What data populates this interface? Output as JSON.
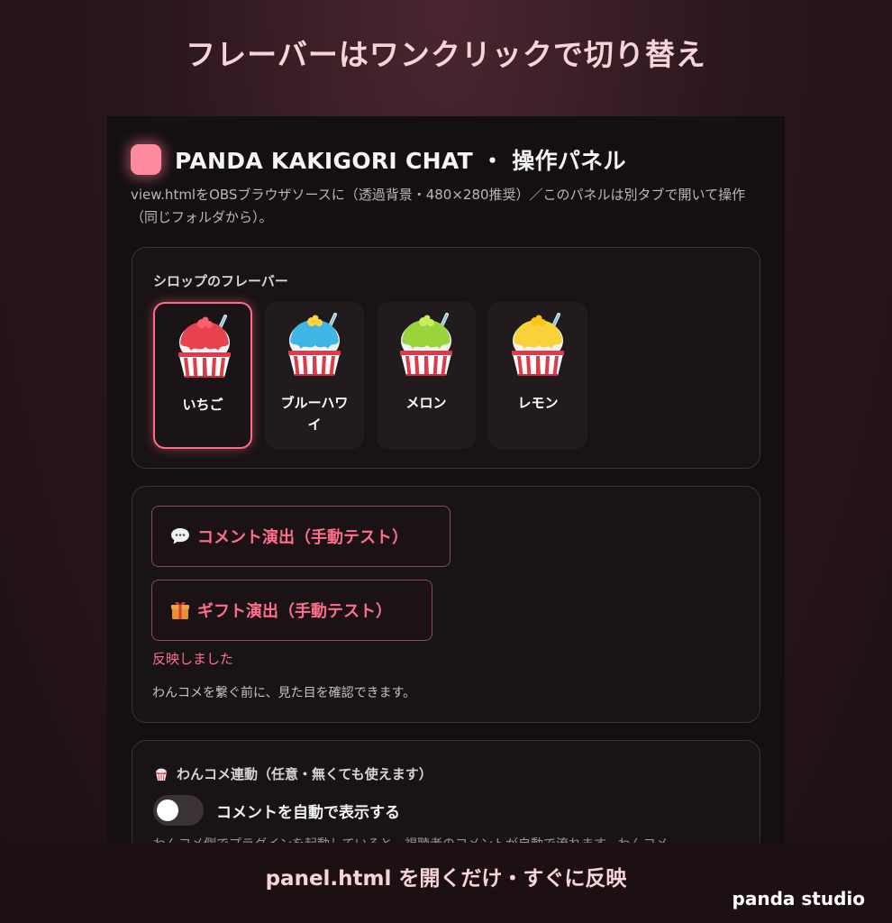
{
  "hero_title": "フレーバーはワンクリックで切り替え",
  "panel": {
    "title": "PANDA KAKIGORI CHAT ・ 操作パネル",
    "description": "view.htmlをOBSブラウザソースに（透過背景・480×280推奨）／このパネルは別タブで開いて操作（同じフォルダから）。"
  },
  "flavor_section": {
    "label": "シロップのフレーバー",
    "selected": "いちご",
    "items": [
      {
        "name": "いちご",
        "syrup_color": "#e8424f",
        "topping_color": "#ff5f6d"
      },
      {
        "name": "ブルーハワイ",
        "syrup_color": "#3fb6e6",
        "topping_color": "#ffd23f"
      },
      {
        "name": "メロン",
        "syrup_color": "#9bd33a",
        "topping_color": "#c7ef5a"
      },
      {
        "name": "レモン",
        "syrup_color": "#f7d23a",
        "topping_color": "#ffc21c"
      }
    ]
  },
  "test_section": {
    "comment_button": {
      "icon": "speech-bubble-icon",
      "label": "コメント演出（手動テスト）"
    },
    "gift_button": {
      "icon": "gift-icon",
      "label": "ギフト演出（手動テスト）"
    },
    "status": "反映しました",
    "hint": "わんコメを繋ぐ前に、見た目を確認できます。"
  },
  "link_section": {
    "title": "わんコメ連動（任意・無くても使えます）",
    "toggle_label": "コメントを自動で表示する",
    "toggle_on": false,
    "cut_text": "わんコメ側でプラグインを起動していると、視聴者のコメントが自動で流れます。わんコメ"
  },
  "sub_caption": "panel.html を開くだけ・すぐに反映",
  "brand": "panda studio",
  "colors": {
    "accent": "#ff6f8c",
    "logo": "#ff8aa0"
  }
}
